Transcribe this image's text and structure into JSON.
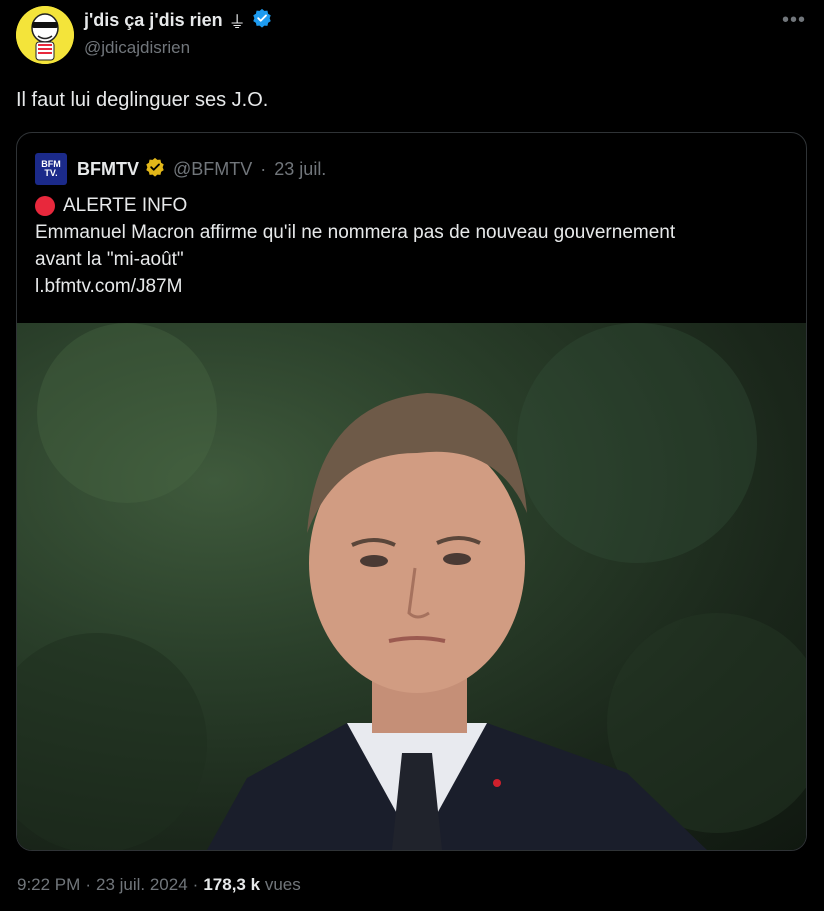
{
  "author": {
    "display_name": "j'dis ça j'dis rien",
    "name_emoji": "⏚",
    "handle": "@jdicajdisrien"
  },
  "tweet_text": "Il faut lui deglinguer ses J.O.",
  "quote": {
    "logo_line1": "BFM",
    "logo_line2": "TV.",
    "name": "BFMTV",
    "handle": "@BFMTV",
    "separator": "·",
    "date": "23 juil.",
    "alert_title": "ALERTE INFO",
    "body_line1": "Emmanuel Macron affirme qu'il ne nommera pas de nouveau gouvernement",
    "body_line2": "avant la \"mi-août\"",
    "link": "l.bfmtv.com/J87M"
  },
  "meta": {
    "time": "9:22 PM",
    "date": "23 juil. 2024",
    "views_count": "178,3 k",
    "views_label": "vues",
    "separator": "·"
  },
  "colors": {
    "background": "#000000",
    "text": "#e7e9ea",
    "secondary": "#71767b",
    "verified_blue": "#1d9bf0",
    "verified_gold": "#e2b719",
    "alert_red": "#e8283c"
  }
}
